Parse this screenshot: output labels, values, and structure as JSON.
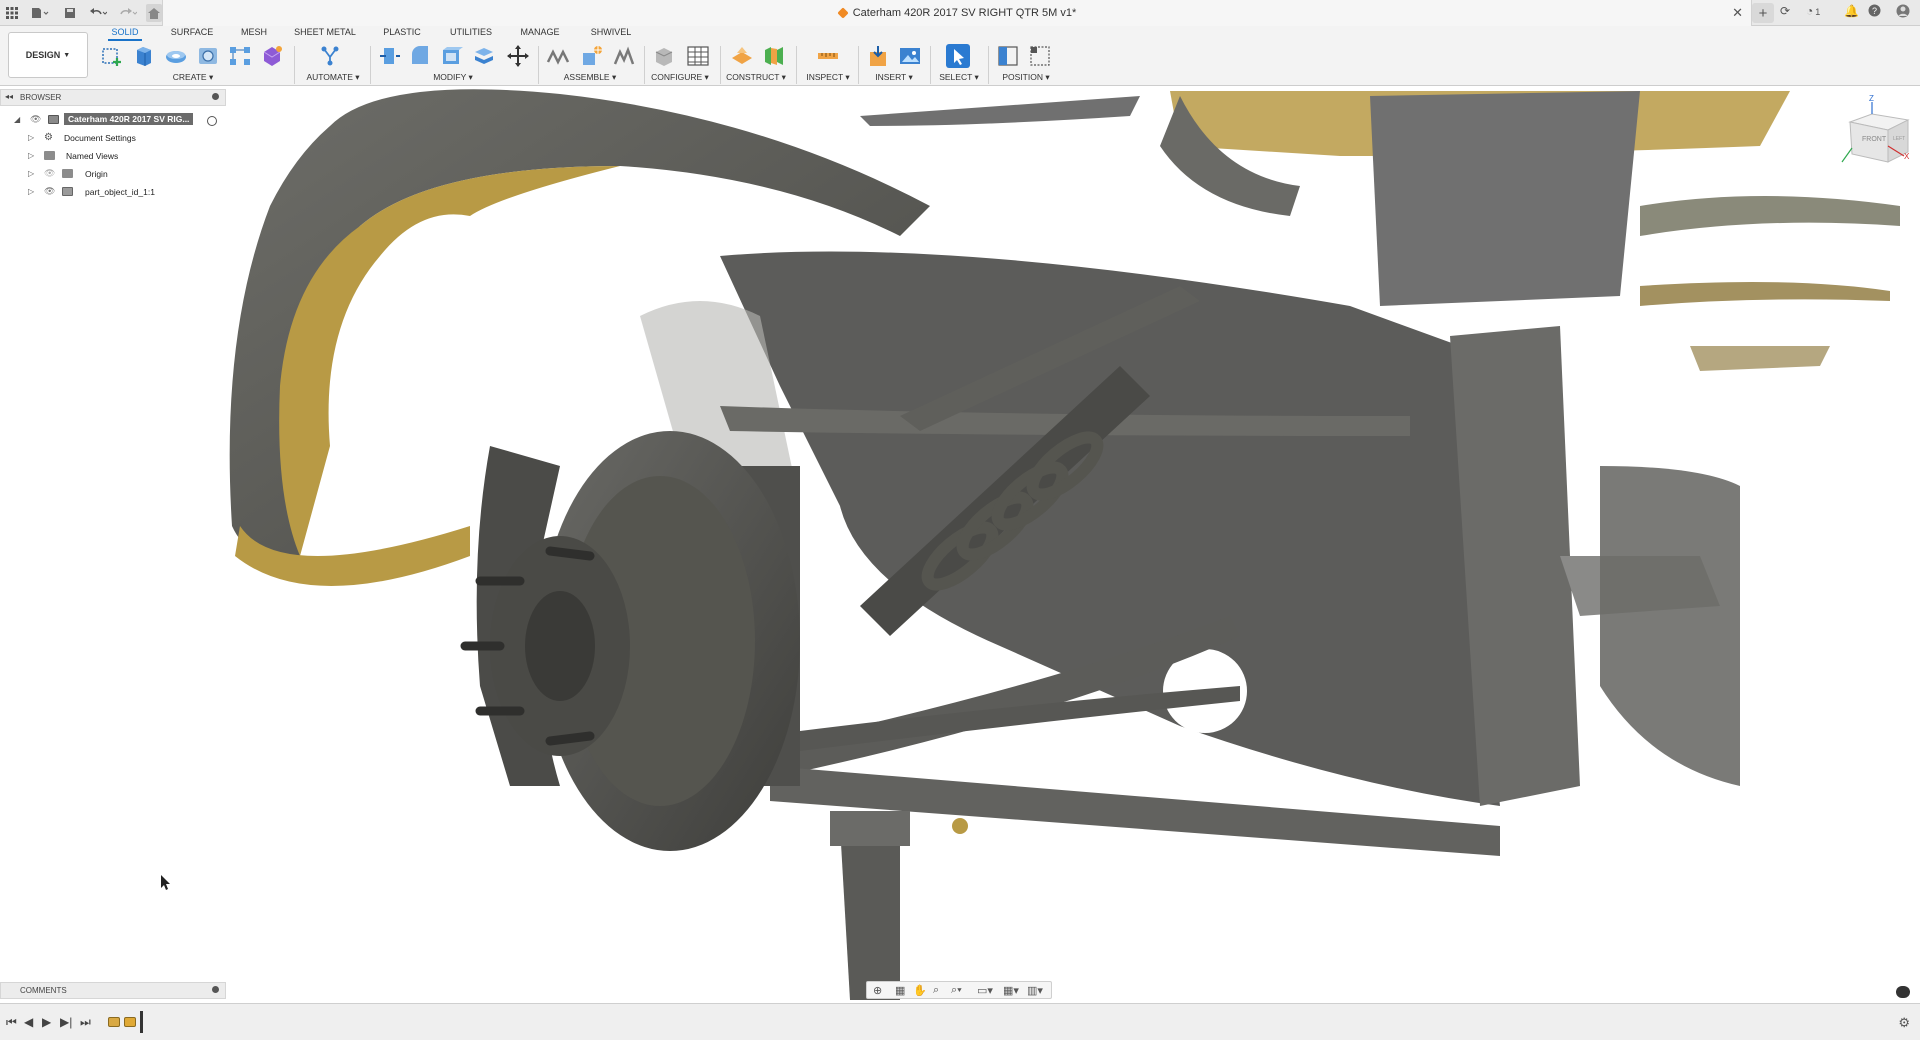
{
  "titlebar": {
    "doc_title": "Caterham 420R 2017 SV RIGHT QTR 5M v1*",
    "job_count": "1",
    "icons": [
      "app-grid-icon",
      "file-icon",
      "save-icon",
      "undo-icon",
      "redo-icon",
      "home-icon",
      "close-icon",
      "new-tab-icon",
      "extensions-icon",
      "job-status-icon",
      "notifications-icon",
      "help-icon",
      "profile-icon"
    ]
  },
  "ribbon": {
    "workspace": "DESIGN",
    "tabs": [
      "SOLID",
      "SURFACE",
      "MESH",
      "SHEET METAL",
      "PLASTIC",
      "UTILITIES",
      "MANAGE",
      "SHWIVEL"
    ],
    "active_tab": "SOLID",
    "groups": {
      "create": "CREATE",
      "automate": "AUTOMATE",
      "modify": "MODIFY",
      "assemble": "ASSEMBLE",
      "configure": "CONFIGURE",
      "construct": "CONSTRUCT",
      "inspect": "INSPECT",
      "insert": "INSERT",
      "select": "SELECT",
      "position": "POSITION"
    },
    "accent": "#1a73c9"
  },
  "browser": {
    "title": "BROWSER",
    "root": "Caterham 420R 2017 SV RIG...",
    "items": [
      {
        "label": "Document Settings",
        "icon": "gear-icon"
      },
      {
        "label": "Named Views",
        "icon": "folder-icon"
      },
      {
        "label": "Origin",
        "icon": "folder-icon"
      },
      {
        "label": "part_object_id_1:1",
        "icon": "body-icon"
      }
    ]
  },
  "viewcube": {
    "z_label": "Z",
    "x_label": "X",
    "front_label": "FRONT",
    "left_label": "LEFT"
  },
  "comments": {
    "title": "COMMENTS"
  },
  "navbar": {
    "icons": [
      "orbit-icon",
      "look-at-icon",
      "pan-icon",
      "zoom-icon",
      "fit-icon",
      "display-settings-icon",
      "grid-icon",
      "viewports-icon"
    ]
  },
  "timeline": {
    "icons": [
      "first-frame-icon",
      "previous-frame-icon",
      "play-icon",
      "next-frame-icon",
      "last-frame-icon",
      "timeline-settings-icon"
    ]
  },
  "viewport": {
    "model": "3D scanned front suspension mesh",
    "colors": {
      "metal": "#5a5a58",
      "mustard": "#b89a45",
      "background": "#ffffff"
    }
  }
}
